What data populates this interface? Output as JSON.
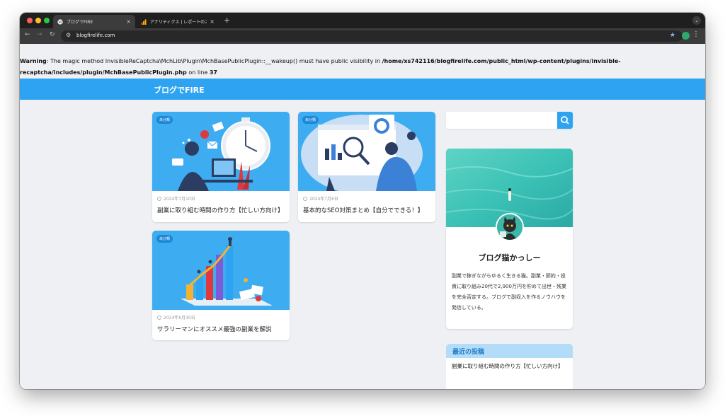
{
  "browser": {
    "tabs": [
      {
        "title": "ブログでFIRE",
        "active": true
      },
      {
        "title": "アナリティクス | レポートのスナ",
        "active": false
      }
    ],
    "url": "blogfirelife.com",
    "new_tab": "+",
    "close_glyph": "×"
  },
  "warning": {
    "label": "Warning",
    "message": ": The magic method InvisibleReCaptcha\\MchLib\\Plugin\\MchBasePublicPlugin::__wakeup() must have public visibility in ",
    "path": "/home/xs742116/blogfirelife.com/public_html/wp-content/plugins/invisible-recaptcha/includes/plugin/MchBasePublicPlugin.php",
    "on_line": " on line ",
    "line": "37"
  },
  "site": {
    "title": "ブログでFIRE",
    "accent": "#2ea3f2"
  },
  "posts": [
    {
      "badge": "未分類",
      "date": "2024年7月10日",
      "title": "副業に取り組む時間の作り方【忙しい方向け】"
    },
    {
      "badge": "未分類",
      "date": "2024年7月6日",
      "title": "基本的なSEO対策まとめ【自分でできる！】"
    },
    {
      "badge": "未分類",
      "date": "2024年6月30日",
      "title": "サラリーマンにオススメ最強の副業を解説"
    }
  ],
  "search": {
    "placeholder": "",
    "icon": "search-icon"
  },
  "profile": {
    "name": "ブログ猫かっしー",
    "bio": "副業で稼ぎながらゆるく生きる猫。副業・節約・投資に取り組み20代で2,900万円を貯めて出世・残業を完全否定する。ブログで副収入を作るノウハウを発信している。"
  },
  "recent": {
    "heading": "最近の投稿",
    "items": [
      "副業に取り組む時間の作り方【忙しい方向け】"
    ]
  }
}
